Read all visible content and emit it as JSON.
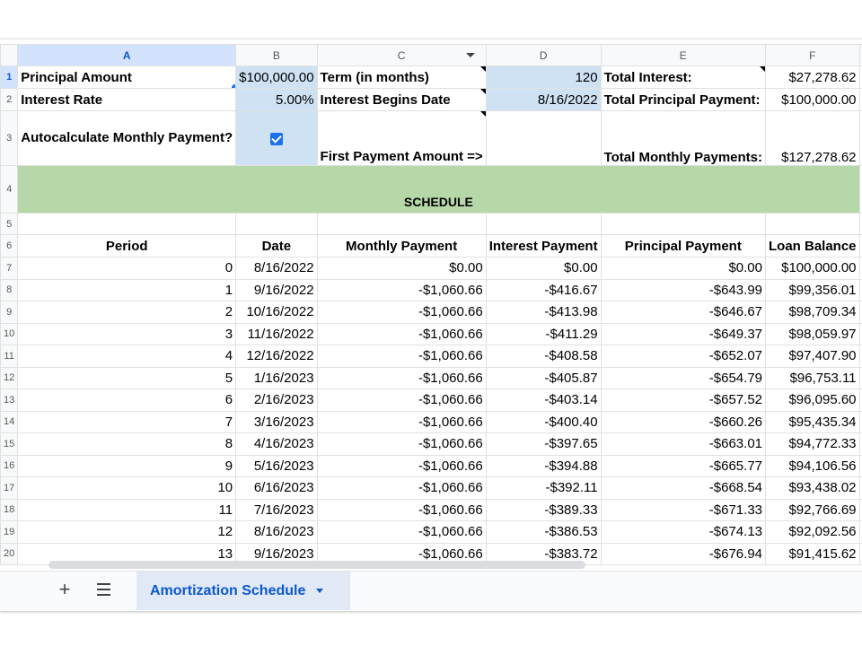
{
  "columns": [
    "A",
    "B",
    "C",
    "D",
    "E",
    "F"
  ],
  "row_numbers": [
    "1",
    "2",
    "3",
    "4",
    "5",
    "6",
    "7",
    "8",
    "9",
    "10",
    "11",
    "12",
    "13",
    "14",
    "15",
    "16",
    "17",
    "18",
    "19",
    "20"
  ],
  "inputs": {
    "principal_label": "Principal Amount",
    "principal_value": "$100,000.00",
    "term_label": "Term (in months)",
    "term_value": "120",
    "total_interest_label": "Total Interest:",
    "total_interest_value": "$27,278.62",
    "rate_label": "Interest Rate",
    "rate_value": "5.00%",
    "begin_label": "Interest Begins Date",
    "begin_value": "8/16/2022",
    "total_principal_label": "Total Principal Payment:",
    "total_principal_value": "$100,000.00",
    "autocalc_label": "Autocalculate Monthly Payment?",
    "autocalc_checked": true,
    "first_payment_label": "First Payment Amount =>",
    "first_payment_value": "",
    "total_monthly_label": "Total Monthly Payments:",
    "total_monthly_value": "$127,278.62"
  },
  "schedule_title": "SCHEDULE",
  "table_headers": [
    "Period",
    "Date",
    "Monthly Payment",
    "Interest Payment",
    "Principal Payment",
    "Loan Balance"
  ],
  "schedule_rows": [
    [
      "0",
      "8/16/2022",
      "$0.00",
      "$0.00",
      "$0.00",
      "$100,000.00"
    ],
    [
      "1",
      "9/16/2022",
      "-$1,060.66",
      "-$416.67",
      "-$643.99",
      "$99,356.01"
    ],
    [
      "2",
      "10/16/2022",
      "-$1,060.66",
      "-$413.98",
      "-$646.67",
      "$98,709.34"
    ],
    [
      "3",
      "11/16/2022",
      "-$1,060.66",
      "-$411.29",
      "-$649.37",
      "$98,059.97"
    ],
    [
      "4",
      "12/16/2022",
      "-$1,060.66",
      "-$408.58",
      "-$652.07",
      "$97,407.90"
    ],
    [
      "5",
      "1/16/2023",
      "-$1,060.66",
      "-$405.87",
      "-$654.79",
      "$96,753.11"
    ],
    [
      "6",
      "2/16/2023",
      "-$1,060.66",
      "-$403.14",
      "-$657.52",
      "$96,095.60"
    ],
    [
      "7",
      "3/16/2023",
      "-$1,060.66",
      "-$400.40",
      "-$660.26",
      "$95,435.34"
    ],
    [
      "8",
      "4/16/2023",
      "-$1,060.66",
      "-$397.65",
      "-$663.01",
      "$94,772.33"
    ],
    [
      "9",
      "5/16/2023",
      "-$1,060.66",
      "-$394.88",
      "-$665.77",
      "$94,106.56"
    ],
    [
      "10",
      "6/16/2023",
      "-$1,060.66",
      "-$392.11",
      "-$668.54",
      "$93,438.02"
    ],
    [
      "11",
      "7/16/2023",
      "-$1,060.66",
      "-$389.33",
      "-$671.33",
      "$92,766.69"
    ],
    [
      "12",
      "8/16/2023",
      "-$1,060.66",
      "-$386.53",
      "-$674.13",
      "$92,092.56"
    ],
    [
      "13",
      "9/16/2023",
      "-$1,060.66",
      "-$383.72",
      "-$676.94",
      "$91,415.62"
    ]
  ],
  "tabbar": {
    "add_icon": "plus-icon",
    "menu_icon": "hamburger-icon",
    "active_sheet": "Amortization Schedule"
  },
  "colors": {
    "input_blue": "#cfe2f3",
    "schedule_green": "#b6d7a8",
    "selection_blue": "#1a73e8"
  }
}
